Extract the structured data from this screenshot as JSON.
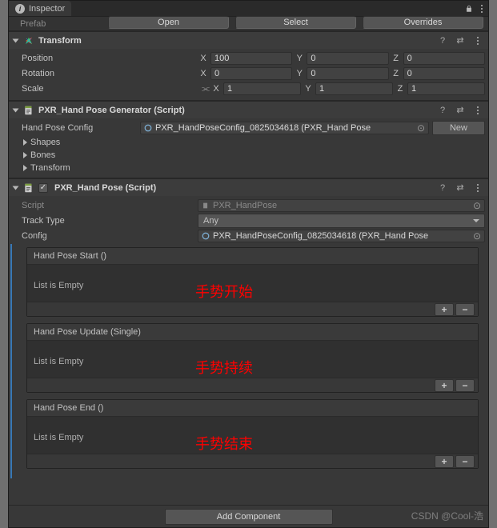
{
  "tab_title": "Inspector",
  "prefab": {
    "label": "Prefab",
    "open": "Open",
    "select": "Select",
    "overrides": "Overrides"
  },
  "transform": {
    "title": "Transform",
    "position_label": "Position",
    "rotation_label": "Rotation",
    "scale_label": "Scale",
    "axes": {
      "x": "X",
      "y": "Y",
      "z": "Z"
    },
    "position": {
      "x": "100",
      "y": "0",
      "z": "0"
    },
    "rotation": {
      "x": "0",
      "y": "0",
      "z": "0"
    },
    "scale": {
      "x": "1",
      "y": "1",
      "z": "1"
    }
  },
  "generator": {
    "title": "PXR_Hand Pose Generator (Script)",
    "config_label": "Hand Pose Config",
    "config_value": "PXR_HandPoseConfig_0825034618 (PXR_Hand Pose",
    "new_label": "New",
    "foldouts": [
      "Shapes",
      "Bones",
      "Transform"
    ]
  },
  "handpose": {
    "title": "PXR_Hand Pose (Script)",
    "script_label": "Script",
    "script_value": "PXR_HandPose",
    "tracktype_label": "Track Type",
    "tracktype_value": "Any",
    "config_label": "Config",
    "config_value": "PXR_HandPoseConfig_0825034618 (PXR_Hand Pose",
    "events": [
      {
        "header": "Hand Pose Start ()",
        "empty": "List is Empty",
        "note": "手势开始"
      },
      {
        "header": "Hand Pose Update (Single)",
        "empty": "List is Empty",
        "note": "手势持续"
      },
      {
        "header": "Hand Pose End ()",
        "empty": "List is Empty",
        "note": "手势结束"
      }
    ]
  },
  "add_component": "Add Component",
  "watermark": "CSDN @Cool-浩",
  "icons": {
    "plus": "+",
    "minus": "−"
  }
}
